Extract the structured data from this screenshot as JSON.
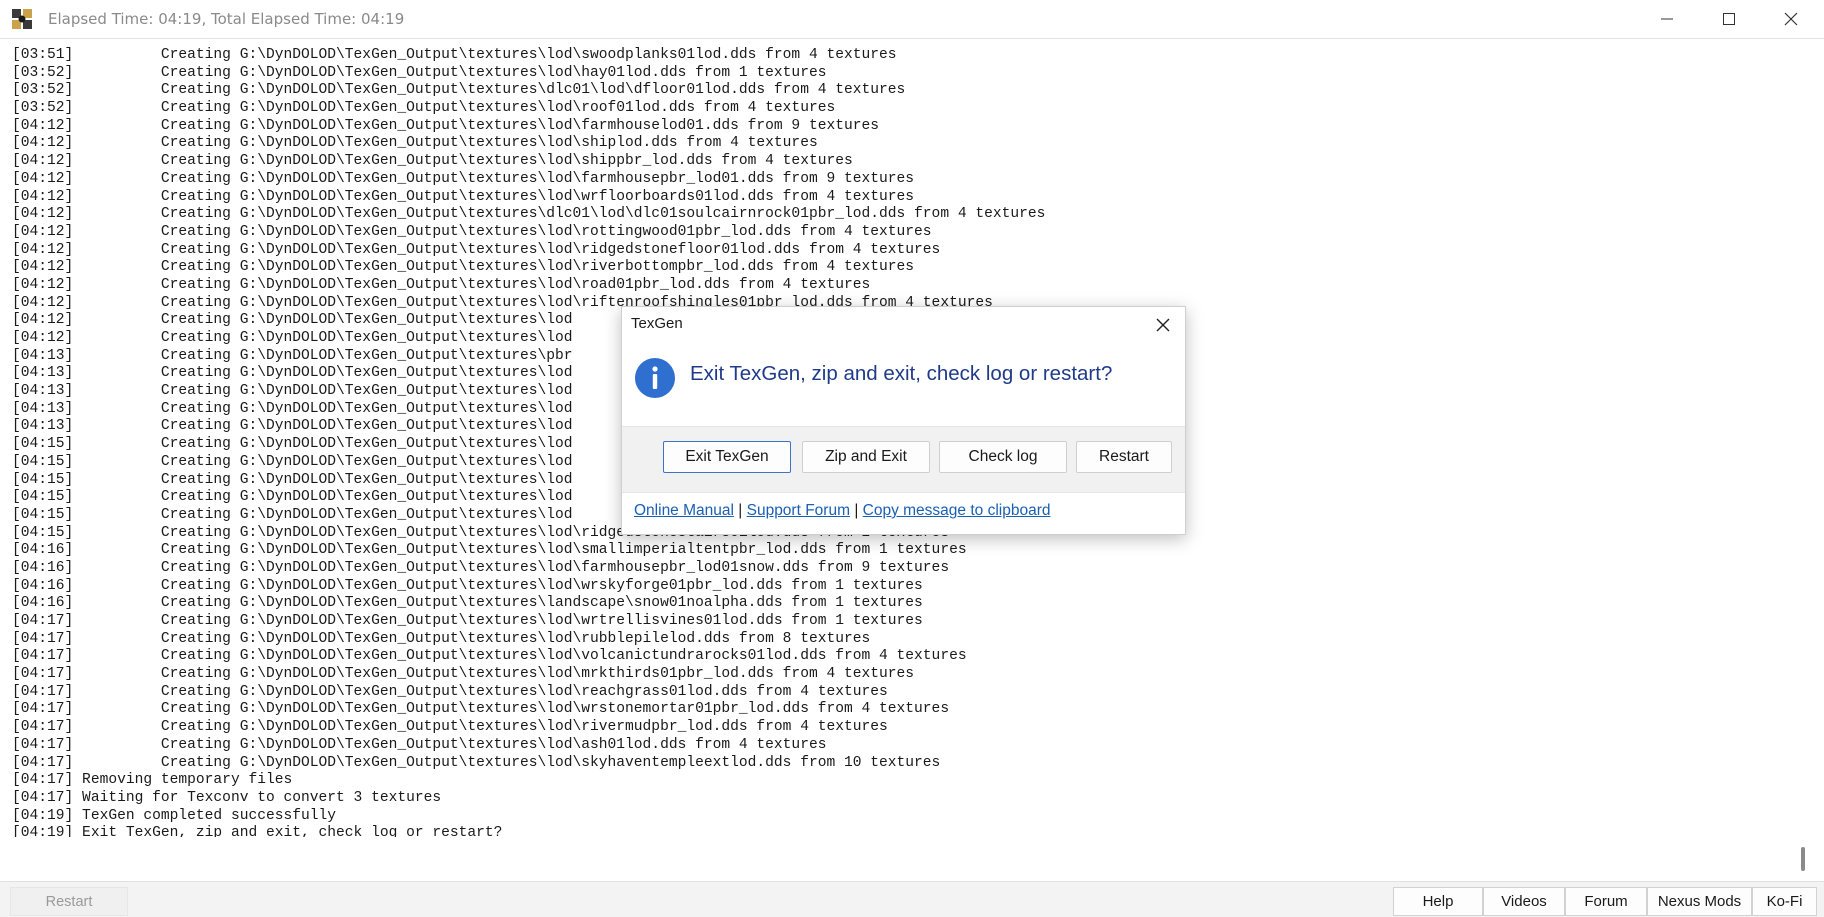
{
  "window": {
    "title": "Elapsed Time: 04:19, Total Elapsed Time: 04:19",
    "icon": "puzzle-app-icon"
  },
  "log": [
    "[03:51]          Creating G:\\DynDOLOD\\TexGen_Output\\textures\\lod\\swoodplanks01lod.dds from 4 textures",
    "[03:52]          Creating G:\\DynDOLOD\\TexGen_Output\\textures\\lod\\hay01lod.dds from 1 textures",
    "[03:52]          Creating G:\\DynDOLOD\\TexGen_Output\\textures\\dlc01\\lod\\dfloor01lod.dds from 4 textures",
    "[03:52]          Creating G:\\DynDOLOD\\TexGen_Output\\textures\\lod\\roof01lod.dds from 4 textures",
    "[04:12]          Creating G:\\DynDOLOD\\TexGen_Output\\textures\\lod\\farmhouselod01.dds from 9 textures",
    "[04:12]          Creating G:\\DynDOLOD\\TexGen_Output\\textures\\lod\\shiplod.dds from 4 textures",
    "[04:12]          Creating G:\\DynDOLOD\\TexGen_Output\\textures\\lod\\shippbr_lod.dds from 4 textures",
    "[04:12]          Creating G:\\DynDOLOD\\TexGen_Output\\textures\\lod\\farmhousepbr_lod01.dds from 9 textures",
    "[04:12]          Creating G:\\DynDOLOD\\TexGen_Output\\textures\\lod\\wrfloorboards01lod.dds from 4 textures",
    "[04:12]          Creating G:\\DynDOLOD\\TexGen_Output\\textures\\dlc01\\lod\\dlc01soulcairnrock01pbr_lod.dds from 4 textures",
    "[04:12]          Creating G:\\DynDOLOD\\TexGen_Output\\textures\\lod\\rottingwood01pbr_lod.dds from 4 textures",
    "[04:12]          Creating G:\\DynDOLOD\\TexGen_Output\\textures\\lod\\ridgedstonefloor01lod.dds from 4 textures",
    "[04:12]          Creating G:\\DynDOLOD\\TexGen_Output\\textures\\lod\\riverbottompbr_lod.dds from 4 textures",
    "[04:12]          Creating G:\\DynDOLOD\\TexGen_Output\\textures\\lod\\road01pbr_lod.dds from 4 textures",
    "[04:12]          Creating G:\\DynDOLOD\\TexGen_Output\\textures\\lod\\riftenroofshingles01pbr_lod.dds from 4 textures",
    "[04:12]          Creating G:\\DynDOLOD\\TexGen_Output\\textures\\lod",
    "[04:12]          Creating G:\\DynDOLOD\\TexGen_Output\\textures\\lod",
    "[04:13]          Creating G:\\DynDOLOD\\TexGen_Output\\textures\\pbr                                                        textures",
    "[04:13]          Creating G:\\DynDOLOD\\TexGen_Output\\textures\\lod",
    "[04:13]          Creating G:\\DynDOLOD\\TexGen_Output\\textures\\lod",
    "[04:13]          Creating G:\\DynDOLOD\\TexGen_Output\\textures\\lod",
    "[04:13]          Creating G:\\DynDOLOD\\TexGen_Output\\textures\\lod",
    "[04:15]          Creating G:\\DynDOLOD\\TexGen_Output\\textures\\lod",
    "[04:15]          Creating G:\\DynDOLOD\\TexGen_Output\\textures\\lod",
    "[04:15]          Creating G:\\DynDOLOD\\TexGen_Output\\textures\\lod",
    "[04:15]          Creating G:\\DynDOLOD\\TexGen_Output\\textures\\lod",
    "[04:15]          Creating G:\\DynDOLOD\\TexGen_Output\\textures\\lod",
    "[04:15]          Creating G:\\DynDOLOD\\TexGen_Output\\textures\\lod\\ridgedstonestairs01lod.dds from 2 textures",
    "[04:16]          Creating G:\\DynDOLOD\\TexGen_Output\\textures\\lod\\smallimperialtentpbr_lod.dds from 1 textures",
    "[04:16]          Creating G:\\DynDOLOD\\TexGen_Output\\textures\\lod\\farmhousepbr_lod01snow.dds from 9 textures",
    "[04:16]          Creating G:\\DynDOLOD\\TexGen_Output\\textures\\lod\\wrskyforge01pbr_lod.dds from 1 textures",
    "[04:16]          Creating G:\\DynDOLOD\\TexGen_Output\\textures\\landscape\\snow01noalpha.dds from 1 textures",
    "[04:17]          Creating G:\\DynDOLOD\\TexGen_Output\\textures\\lod\\wrtrellisvines01lod.dds from 1 textures",
    "[04:17]          Creating G:\\DynDOLOD\\TexGen_Output\\textures\\lod\\rubblepilelod.dds from 8 textures",
    "[04:17]          Creating G:\\DynDOLOD\\TexGen_Output\\textures\\lod\\volcanictundrarocks01lod.dds from 4 textures",
    "[04:17]          Creating G:\\DynDOLOD\\TexGen_Output\\textures\\lod\\mrkthirds01pbr_lod.dds from 4 textures",
    "[04:17]          Creating G:\\DynDOLOD\\TexGen_Output\\textures\\lod\\reachgrass01lod.dds from 4 textures",
    "[04:17]          Creating G:\\DynDOLOD\\TexGen_Output\\textures\\lod\\wrstonemortar01pbr_lod.dds from 4 textures",
    "[04:17]          Creating G:\\DynDOLOD\\TexGen_Output\\textures\\lod\\rivermudpbr_lod.dds from 4 textures",
    "[04:17]          Creating G:\\DynDOLOD\\TexGen_Output\\textures\\lod\\ash01lod.dds from 4 textures",
    "[04:17]          Creating G:\\DynDOLOD\\TexGen_Output\\textures\\lod\\skyhaventempleextlod.dds from 10 textures",
    "[04:17] Removing temporary files",
    "[04:17] Waiting for Texconv to convert 3 textures",
    "[04:19] TexGen completed successfully",
    "[04:19] Exit TexGen, zip and exit, check log or restart?"
  ],
  "footer": {
    "restart": "Restart",
    "help": "Help",
    "videos": "Videos",
    "forum": "Forum",
    "nexus": "Nexus Mods",
    "kofi": "Ko-Fi"
  },
  "dialog": {
    "title": "TexGen",
    "message": "Exit TexGen, zip and exit, check log or restart?",
    "icon": "info-icon",
    "buttons": {
      "exit": "Exit TexGen",
      "zip_exit": "Zip and Exit",
      "check_log": "Check log",
      "restart": "Restart"
    },
    "links": {
      "manual": "Online Manual",
      "forum": "Support Forum",
      "copy": "Copy message to clipboard",
      "separator": "|"
    }
  },
  "colors": {
    "accent": "#1a5fb4",
    "info_icon": "#2f6fd0",
    "message_text": "#1f3a8a",
    "default_button_border": "#3d72c9"
  }
}
